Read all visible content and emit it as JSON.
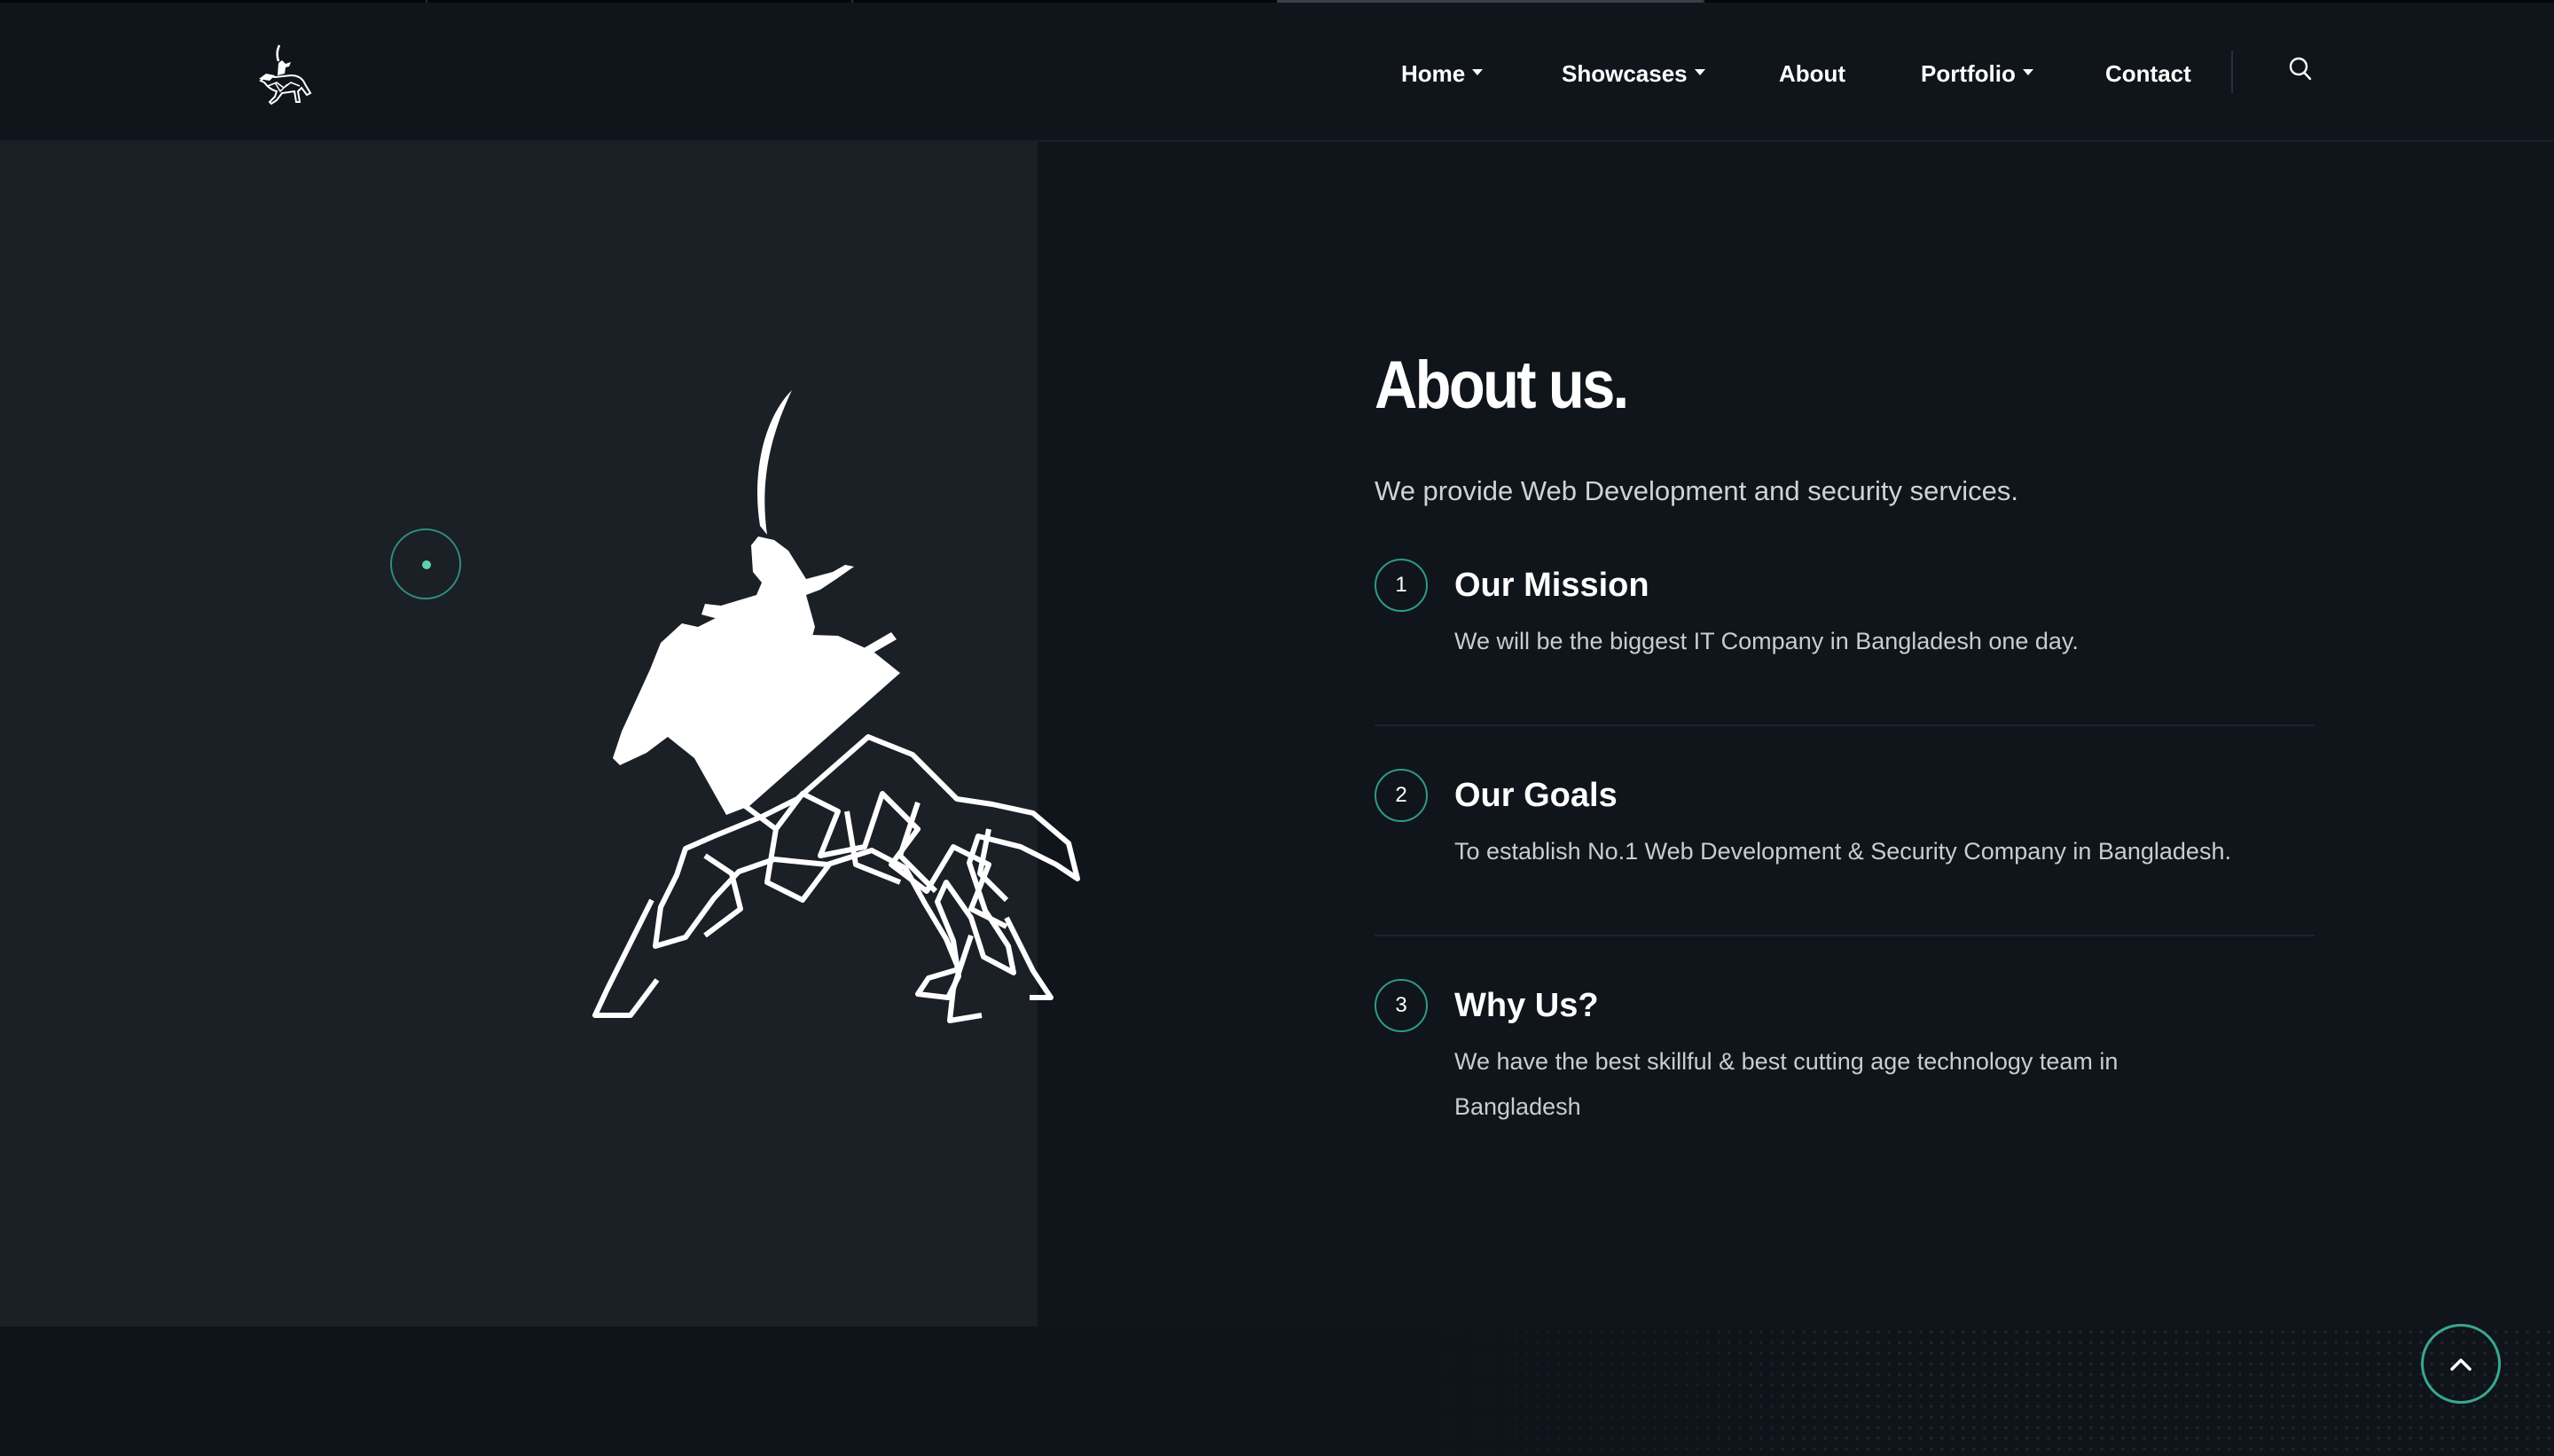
{
  "nav": {
    "items": [
      {
        "label": "Home",
        "dropdown": true
      },
      {
        "label": "Showcases",
        "dropdown": true
      },
      {
        "label": "About",
        "dropdown": false
      },
      {
        "label": "Portfolio",
        "dropdown": true
      },
      {
        "label": "Contact",
        "dropdown": false
      }
    ],
    "search_icon": "search-icon"
  },
  "logo": {
    "icon": "horse-rider-logo"
  },
  "about": {
    "title": "About us.",
    "subtitle": "We provide Web Development and security services.",
    "items": [
      {
        "number": "1",
        "title": "Our Mission",
        "text": "We will be the biggest IT Company in Bangladesh one day."
      },
      {
        "number": "2",
        "title": "Our Goals",
        "text": "To establish No.1 Web Development & Security Company in Bangladesh."
      },
      {
        "number": "3",
        "title": "Why Us?",
        "text": "We have the best skillful & best cutting age technology team in Bangladesh"
      }
    ]
  },
  "colors": {
    "background": "#10141b",
    "panel": "#1b1f26",
    "accent": "#3aa88c",
    "text": "#ffffff"
  },
  "scroll_top": {
    "icon": "chevron-up-icon"
  }
}
